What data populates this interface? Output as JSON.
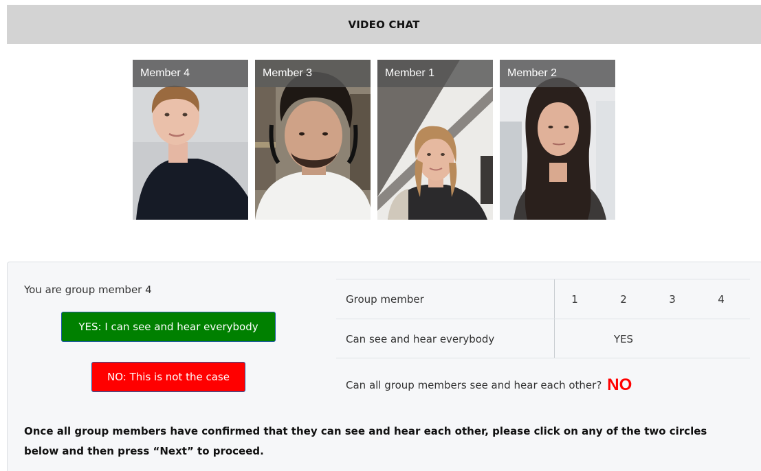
{
  "header": {
    "title": "VIDEO CHAT"
  },
  "video_tiles": [
    {
      "label": "Member 4"
    },
    {
      "label": "Member 3"
    },
    {
      "label": "Member 1"
    },
    {
      "label": "Member 2"
    }
  ],
  "panel": {
    "member_info": "You are group member 4",
    "yes_button": "YES: I can see and hear everybody",
    "no_button": "NO: This is not the case",
    "table": {
      "header_label": "Group member",
      "columns": [
        "1",
        "2",
        "3",
        "4"
      ],
      "row_label": "Can see and hear everybody",
      "values": [
        "",
        "YES",
        "",
        ""
      ]
    },
    "question": "Can all group members see and hear each other?",
    "answer": "NO",
    "instructions": "Once all group members have confirmed that they can see and hear each other, please click on any of the two circles below and then press “Next” to proceed."
  },
  "colors": {
    "yes": "#008000",
    "no": "#ff0000",
    "header_bg": "#d3d3d3",
    "panel_bg": "#f6f7f9"
  }
}
